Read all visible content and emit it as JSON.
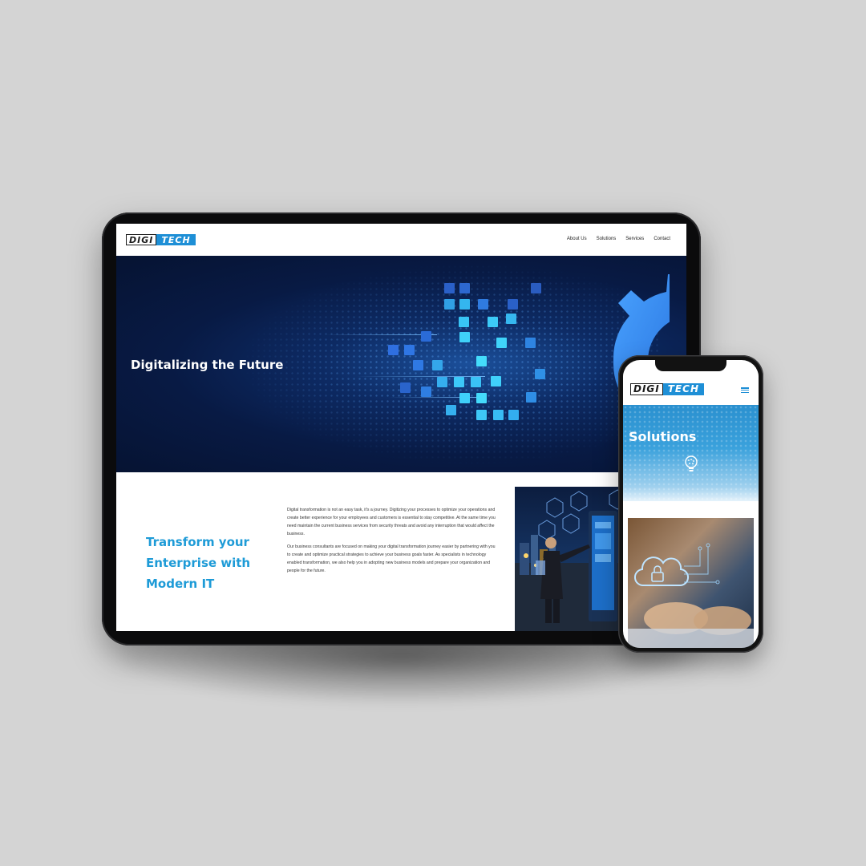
{
  "brand": {
    "logo_part1": "DIGI",
    "logo_part2": "TECH",
    "accent": "#1e8fd6",
    "heading_color": "#1e9bd7"
  },
  "tablet": {
    "nav": [
      "About Us",
      "Solutions",
      "Services",
      "Contact"
    ],
    "hero": {
      "title": "Digitalizing the Future"
    },
    "section": {
      "title": "Transform your Enterprise with Modern IT",
      "paragraphs": [
        "Digital transformation is not an easy task, it's a journey. Digitizing your processes to optimize your operations and create better experience for your employees and customers is essential to stay competitive. At the same time you need maintain the current business services from security threats and avoid any interruption that would affect the business.",
        "Our business consultants are focused on making your digital transformation journey easier by partnering with you to create and optimize practical strategies to achieve your business goals faster. As specialists in technology enabled transformation, we also help you in adopting new business models and prepare your organization and people for the future."
      ]
    }
  },
  "phone": {
    "hero": {
      "title": "Solutions"
    },
    "menu_icon": "hamburger-menu-icon",
    "hero_icon": "lightbulb-icon"
  }
}
